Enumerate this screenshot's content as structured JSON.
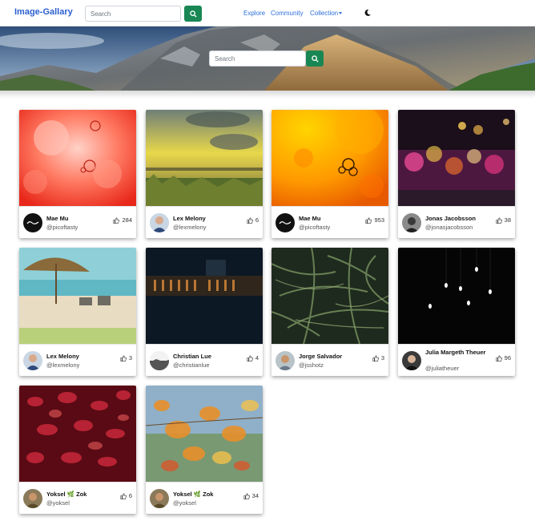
{
  "navbar": {
    "brand": "Image-Gallary",
    "search_placeholder": "Search",
    "links": {
      "explore": "Explore",
      "community": "Community",
      "collection": "Collection"
    },
    "accent": "#198754",
    "link_color": "#2b6fd9"
  },
  "hero": {
    "search_placeholder": "Search"
  },
  "cards": [
    {
      "name": "Mae Mu",
      "handle": "@picoftasty",
      "likes": "284",
      "avatar": "brand-logo"
    },
    {
      "name": "Lex Melony",
      "handle": "@lexmelony",
      "likes": "6",
      "avatar": "person-photo"
    },
    {
      "name": "Mae Mu",
      "handle": "@picoftasty",
      "likes": "953",
      "avatar": "brand-logo"
    },
    {
      "name": "Jonas Jacobsson",
      "handle": "@jonasjacobsson",
      "likes": "38",
      "avatar": "person-photo"
    },
    {
      "name": "Lex Melony",
      "handle": "@lexmelony",
      "likes": "3",
      "avatar": "person-photo"
    },
    {
      "name": "Christian Lue",
      "handle": "@christianlue",
      "likes": "4",
      "avatar": "landscape-photo"
    },
    {
      "name": "Jorge Salvador",
      "handle": "@jsshotz",
      "likes": "3",
      "avatar": "person-photo"
    },
    {
      "name": "Julia Margeth Theuer",
      "handle": "@juliatheuer",
      "likes": "96",
      "avatar": "person-photo"
    },
    {
      "name": "Yoksel 🌿 Zok",
      "handle": "@yoksel",
      "likes": "6",
      "avatar": "person-photo"
    },
    {
      "name": "Yoksel 🌿 Zok",
      "handle": "@yoksel",
      "likes": "34",
      "avatar": "person-photo"
    }
  ],
  "icons": {
    "search": "search-icon",
    "theme": "moon-icon",
    "like": "thumbs-up-icon"
  }
}
